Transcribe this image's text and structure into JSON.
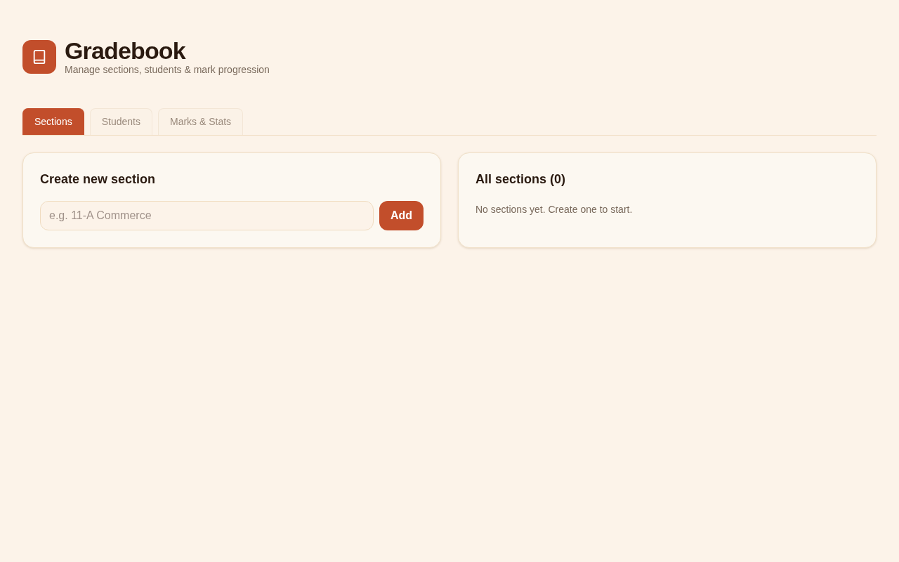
{
  "header": {
    "title": "Gradebook",
    "subtitle": "Manage sections, students & mark progression"
  },
  "tabs": [
    {
      "label": "Sections",
      "selected": true
    },
    {
      "label": "Students",
      "selected": false
    },
    {
      "label": "Marks & Stats",
      "selected": false
    }
  ],
  "create_card": {
    "title": "Create new section",
    "input": {
      "placeholder": "e.g. 11-A Commerce"
    },
    "button": "Add"
  },
  "list_card": {
    "title": "All sections (0)",
    "empty_message": "No sections yet. Create one to start."
  }
}
